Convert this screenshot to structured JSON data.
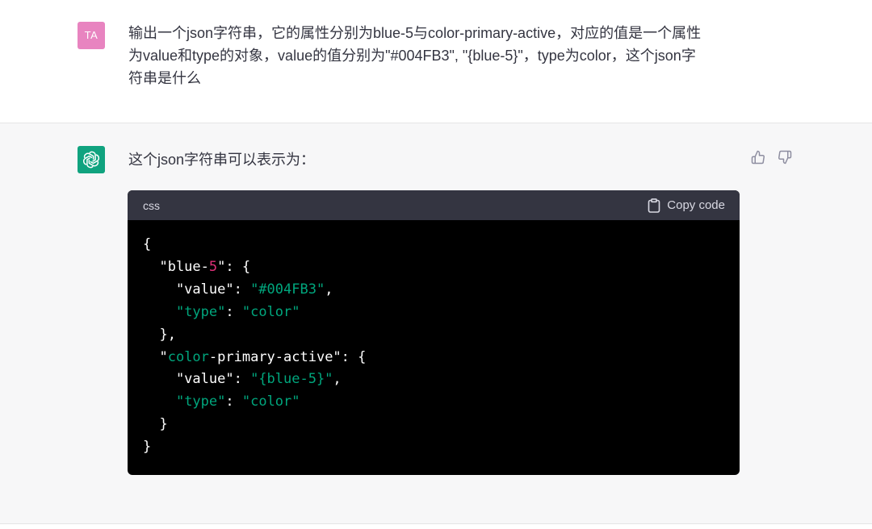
{
  "user": {
    "avatar_initials": "TA",
    "avatar_color": "#e884c0",
    "message_line1": "输出一个json字符串，它的属性分别为blue-5与color-primary-active，对应的值是一个属性",
    "message_line2": "为value和type的对象，value的值分别为\"#004FB3\", \"{blue-5}\"，type为color，这个json字",
    "message_line3": "符串是什么"
  },
  "assistant": {
    "avatar_icon": "openai-logo-icon",
    "avatar_color": "#10a37f",
    "intro": "这个json字符串可以表示为：",
    "feedback": {
      "thumbs_up_icon": "thumbs-up-icon",
      "thumbs_down_icon": "thumbs-down-icon"
    },
    "code_block": {
      "language": "css",
      "copy_label": "Copy code",
      "copy_icon": "clipboard-icon",
      "lines": [
        [
          {
            "t": "{",
            "c": "tk-punc"
          }
        ],
        [
          {
            "t": "  \"blue-",
            "c": "tk-plain"
          },
          {
            "t": "5",
            "c": "tk-num"
          },
          {
            "t": "\": {",
            "c": "tk-plain"
          }
        ],
        [
          {
            "t": "    \"value\": ",
            "c": "tk-plain"
          },
          {
            "t": "\"#004FB3\"",
            "c": "tk-str"
          },
          {
            "t": ",",
            "c": "tk-punc"
          }
        ],
        [
          {
            "t": "    ",
            "c": "tk-plain"
          },
          {
            "t": "\"type\"",
            "c": "tk-str"
          },
          {
            "t": ": ",
            "c": "tk-punc"
          },
          {
            "t": "\"color\"",
            "c": "tk-str"
          }
        ],
        [
          {
            "t": "  },",
            "c": "tk-punc"
          }
        ],
        [
          {
            "t": "  \"",
            "c": "tk-plain"
          },
          {
            "t": "color",
            "c": "tk-str"
          },
          {
            "t": "-primary-active\": {",
            "c": "tk-plain"
          }
        ],
        [
          {
            "t": "    \"value\": ",
            "c": "tk-plain"
          },
          {
            "t": "\"{blue-5}\"",
            "c": "tk-str"
          },
          {
            "t": ",",
            "c": "tk-punc"
          }
        ],
        [
          {
            "t": "    ",
            "c": "tk-plain"
          },
          {
            "t": "\"type\"",
            "c": "tk-str"
          },
          {
            "t": ": ",
            "c": "tk-punc"
          },
          {
            "t": "\"color\"",
            "c": "tk-str"
          }
        ],
        [
          {
            "t": "  }",
            "c": "tk-punc"
          }
        ],
        [
          {
            "t": "}",
            "c": "tk-punc"
          }
        ]
      ]
    }
  }
}
